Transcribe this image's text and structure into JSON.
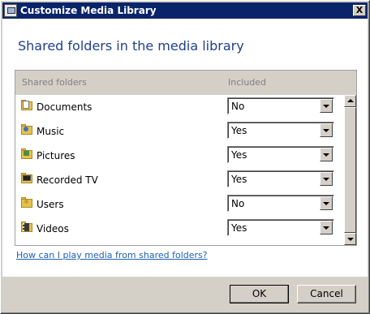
{
  "window": {
    "title": "Customize Media Library",
    "close_label": "X"
  },
  "heading": "Shared folders in the media library",
  "table": {
    "columns": [
      "Shared folders",
      "Included"
    ],
    "rows": [
      {
        "folder": "Documents",
        "included": "No",
        "icon": "documents-folder-icon"
      },
      {
        "folder": "Music",
        "included": "Yes",
        "icon": "music-folder-icon"
      },
      {
        "folder": "Pictures",
        "included": "Yes",
        "icon": "pictures-folder-icon"
      },
      {
        "folder": "Recorded TV",
        "included": "Yes",
        "icon": "recorded-tv-folder-icon"
      },
      {
        "folder": "Users",
        "included": "No",
        "icon": "users-folder-icon"
      },
      {
        "folder": "Videos",
        "included": "Yes",
        "icon": "videos-folder-icon"
      }
    ]
  },
  "help_link": "How can I play media from shared folders?",
  "buttons": {
    "ok": "OK",
    "cancel": "Cancel"
  },
  "colors": {
    "title_bar": "#0a246a",
    "heading": "#1f3f8f",
    "link": "#1f5fb0",
    "dialog_bg": "#d4d0c8"
  }
}
